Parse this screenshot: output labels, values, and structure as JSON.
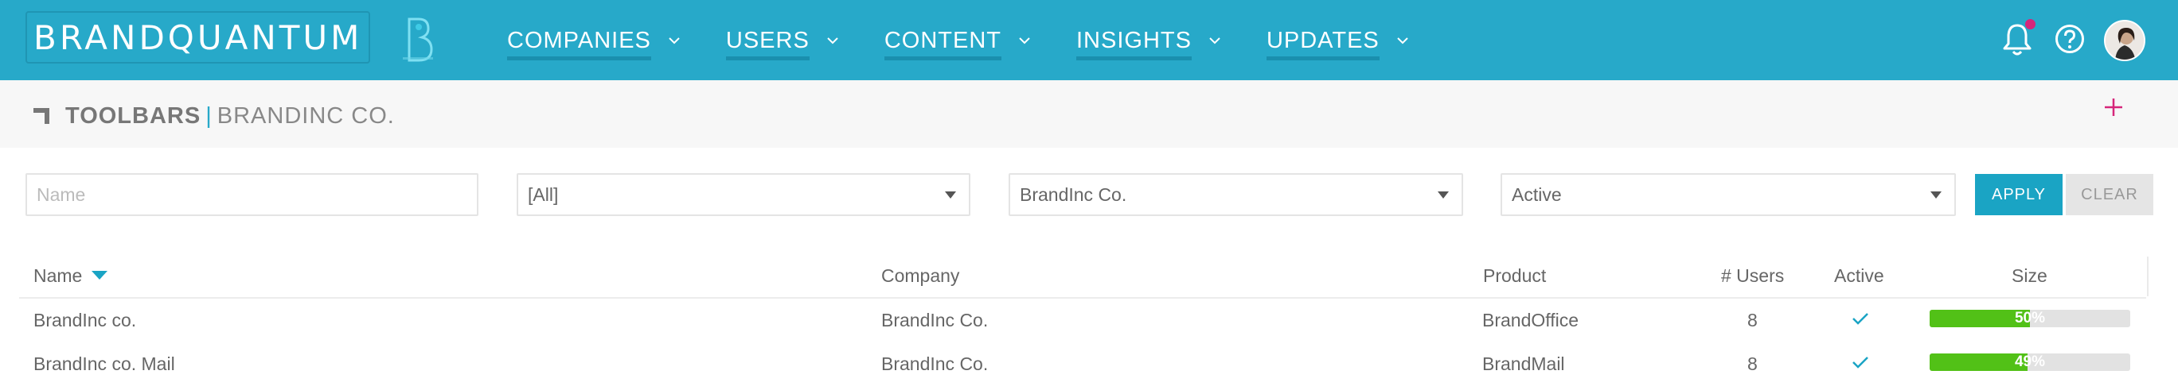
{
  "app": {
    "brand": "BRANDQUANTUM"
  },
  "nav": [
    {
      "label": "COMPANIES"
    },
    {
      "label": "USERS"
    },
    {
      "label": "CONTENT"
    },
    {
      "label": "INSIGHTS"
    },
    {
      "label": "UPDATES"
    }
  ],
  "header": {
    "title": "TOOLBARS",
    "separator": "|",
    "subtitle": "BRANDINC CO."
  },
  "filters": {
    "name_placeholder": "Name",
    "type_value": "[All]",
    "company_value": "BrandInc Co.",
    "status_value": "Active",
    "apply_label": "APPLY",
    "clear_label": "CLEAR"
  },
  "table": {
    "columns": {
      "name": "Name",
      "company": "Company",
      "product": "Product",
      "users": "# Users",
      "active": "Active",
      "size": "Size"
    },
    "rows": [
      {
        "name": "BrandInc co.",
        "company": "BrandInc Co.",
        "product": "BrandOffice",
        "users": "8",
        "active": true,
        "size_percent": 50,
        "size_label": "50%"
      },
      {
        "name": "BrandInc co. Mail",
        "company": "BrandInc Co.",
        "product": "BrandMail",
        "users": "8",
        "active": true,
        "size_percent": 49,
        "size_label": "49%"
      }
    ]
  },
  "colors": {
    "accent": "#27a9c9",
    "notification": "#d6267a",
    "progress": "#52c117",
    "add": "#d6267a"
  },
  "icons": {
    "bell": "bell-icon",
    "help": "help-icon",
    "add": "plus-icon",
    "sort": "sort-desc-icon",
    "check": "check-icon"
  }
}
